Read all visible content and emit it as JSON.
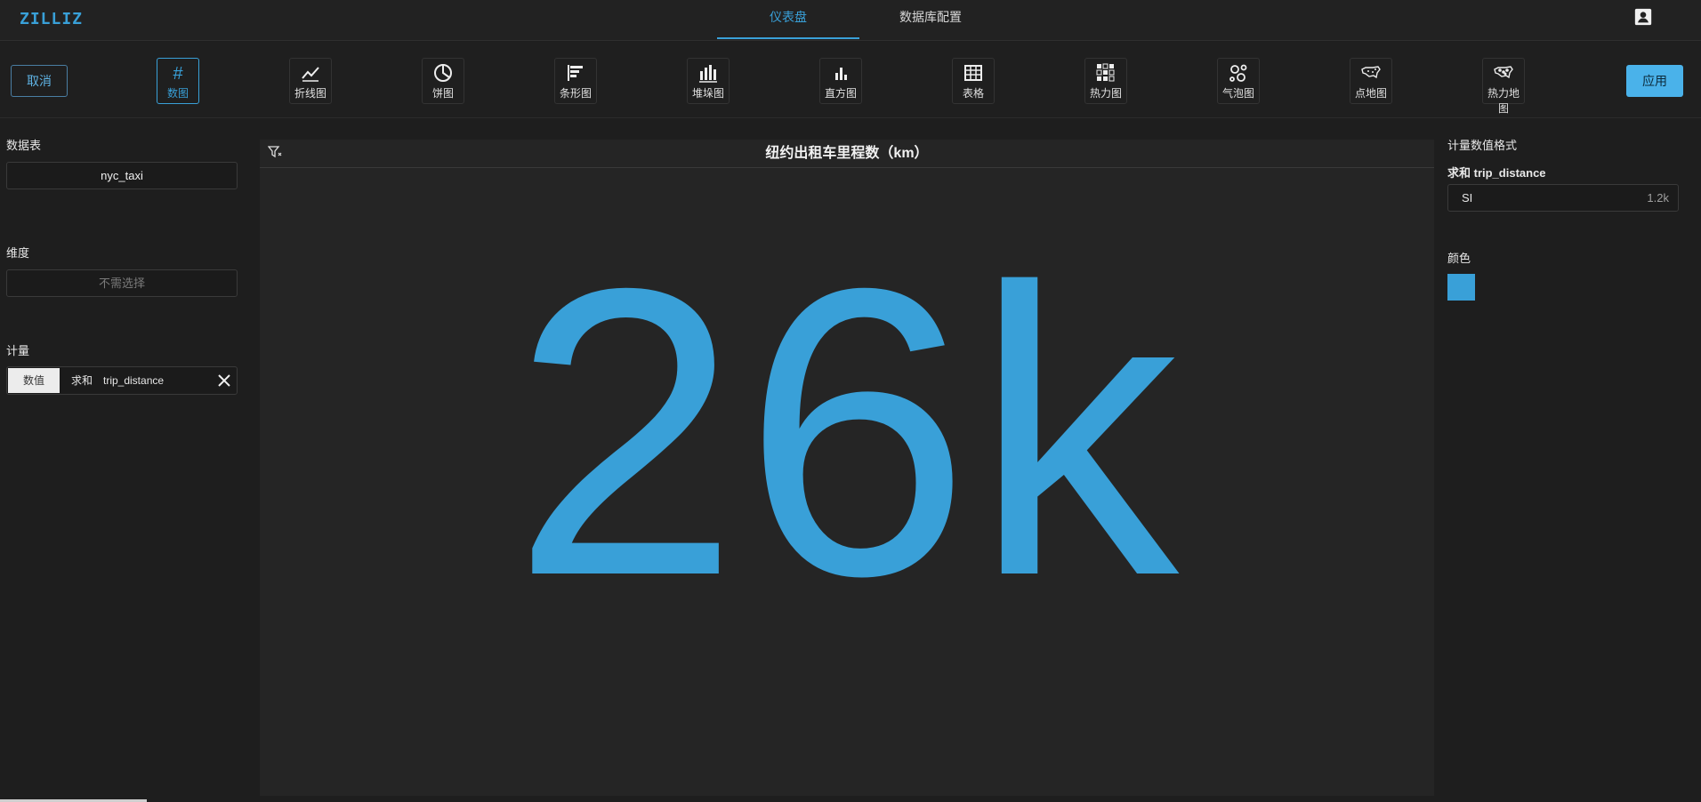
{
  "app": {
    "logo": "ZILLIZ"
  },
  "nav": {
    "tabs": [
      {
        "label": "仪表盘",
        "active": true
      },
      {
        "label": "数据库配置",
        "active": false
      }
    ]
  },
  "toolbar": {
    "cancel_label": "取消",
    "apply_label": "应用",
    "chart_types": [
      {
        "id": "number",
        "label": "数图",
        "icon": "hash-icon",
        "active": true
      },
      {
        "id": "line",
        "label": "折线图",
        "icon": "line-chart-icon"
      },
      {
        "id": "pie",
        "label": "饼图",
        "icon": "pie-chart-icon"
      },
      {
        "id": "bar",
        "label": "条形图",
        "icon": "bar-chart-icon"
      },
      {
        "id": "stacked",
        "label": "堆垛图",
        "icon": "stacked-bar-icon"
      },
      {
        "id": "histogram",
        "label": "直方图",
        "icon": "histogram-icon"
      },
      {
        "id": "table",
        "label": "表格",
        "icon": "table-icon"
      },
      {
        "id": "heatmap",
        "label": "热力图",
        "icon": "heatmap-icon"
      },
      {
        "id": "bubble",
        "label": "气泡图",
        "icon": "bubble-chart-icon"
      },
      {
        "id": "pointmap",
        "label": "点地图",
        "icon": "point-map-icon"
      },
      {
        "id": "geoheat",
        "label": "热力地图",
        "icon": "heat-map-icon"
      }
    ]
  },
  "left_panel": {
    "table_title": "数据表",
    "table_value": "nyc_taxi",
    "dimension_title": "维度",
    "dimension_placeholder": "不需选择",
    "measure_title": "计量",
    "measure": {
      "type": "数值",
      "aggregation": "求和",
      "field": "trip_distance"
    }
  },
  "main": {
    "title": "纽约出租车里程数（km）",
    "value": "26k"
  },
  "right_panel": {
    "format_title": "计量数值格式",
    "measure_label": "求和 trip_distance",
    "format_name": "SI",
    "format_example": "1.2k",
    "color_title": "颜色",
    "color": "#39a0d8"
  }
}
